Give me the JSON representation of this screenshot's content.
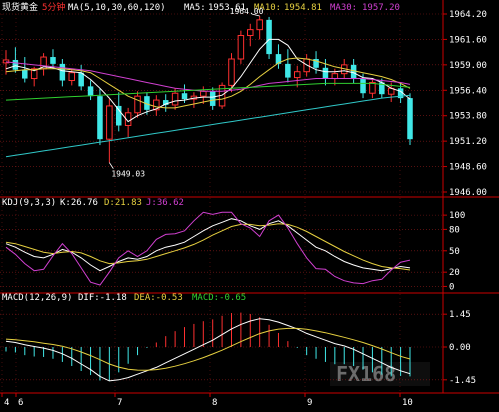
{
  "main_panel": {
    "symbol": "现货黄金",
    "period": "5分钟",
    "indicator": "MA(5,10,30,60,120)",
    "ma5_label": "MA5:",
    "ma5_value": "1953.61",
    "ma10_label": "MA10:",
    "ma10_value": "1954.81",
    "ma30_label": "MA30:",
    "ma30_value": "1957.20",
    "high_label": "1964.00",
    "low_label": "1949.03",
    "ticks": [
      "1964.20",
      "1961.60",
      "1959.00",
      "1956.40",
      "1953.80",
      "1951.20",
      "1948.60",
      "1946.00"
    ]
  },
  "kdj_panel": {
    "title": "KDJ(9,3,3)",
    "k_text": "K:26.76",
    "d_text": "D:21.83",
    "j_text": "J:36.62",
    "ticks": [
      "100",
      "80",
      "50",
      "20",
      "0"
    ]
  },
  "macd_panel": {
    "title": "MACD(12,26,9)",
    "dif_text": "DIF:-1.18",
    "dea_text": "DEA:-0.53",
    "macd_text": "MACD:-0.65",
    "ticks": [
      "1.45",
      "0.00",
      "-1.45"
    ]
  },
  "x_axis": {
    "labels": [
      "4",
      "6",
      "7",
      "8",
      "9",
      "10"
    ]
  },
  "watermark": "FX168",
  "colors": {
    "background": "#000000",
    "up": "#ff3030",
    "down": "#40e8e8",
    "ma5": "#ffffff",
    "ma10": "#e6d040",
    "ma30": "#d040d0",
    "ma60": "#30d030",
    "ma120": "#30c8c8",
    "grid": "#8a1a1a",
    "separator": "#cc0000"
  },
  "chart_data": [
    {
      "type": "candlestick",
      "panel": "price",
      "ylim": [
        1946.0,
        1964.2
      ],
      "x_labels": [
        "4",
        "6",
        "7",
        "8",
        "9",
        "10"
      ],
      "series": [
        {
          "name": "candles",
          "ohlc": [
            [
              1959.2,
              1960.5,
              1958.0,
              1959.5
            ],
            [
              1959.5,
              1960.8,
              1958.2,
              1958.5
            ],
            [
              1958.5,
              1959.8,
              1957.2,
              1957.6
            ],
            [
              1957.6,
              1958.8,
              1956.8,
              1958.6
            ],
            [
              1958.6,
              1960.2,
              1957.9,
              1959.8
            ],
            [
              1959.8,
              1960.6,
              1958.6,
              1959.1
            ],
            [
              1959.1,
              1959.6,
              1956.8,
              1957.4
            ],
            [
              1957.4,
              1958.6,
              1956.9,
              1958.2
            ],
            [
              1958.2,
              1959.0,
              1956.4,
              1956.8
            ],
            [
              1956.8,
              1957.4,
              1955.4,
              1955.8
            ],
            [
              1955.8,
              1956.6,
              1950.8,
              1951.4
            ],
            [
              1951.4,
              1955.5,
              1949.0,
              1954.8
            ],
            [
              1954.8,
              1956.2,
              1952.2,
              1952.8
            ],
            [
              1952.8,
              1954.6,
              1951.6,
              1954.1
            ],
            [
              1954.1,
              1956.3,
              1953.6,
              1955.8
            ],
            [
              1955.8,
              1956.2,
              1953.9,
              1954.4
            ],
            [
              1954.4,
              1955.9,
              1953.8,
              1955.4
            ],
            [
              1955.4,
              1956.0,
              1954.2,
              1954.9
            ],
            [
              1954.9,
              1956.6,
              1954.4,
              1956.1
            ],
            [
              1956.1,
              1957.0,
              1955.1,
              1955.5
            ],
            [
              1955.5,
              1956.2,
              1954.6,
              1955.8
            ],
            [
              1955.8,
              1956.8,
              1955.0,
              1956.3
            ],
            [
              1956.3,
              1956.7,
              1954.4,
              1954.8
            ],
            [
              1954.8,
              1957.2,
              1954.5,
              1956.9
            ],
            [
              1956.9,
              1960.2,
              1956.2,
              1959.6
            ],
            [
              1959.6,
              1962.5,
              1959.1,
              1962.0
            ],
            [
              1962.0,
              1963.2,
              1960.9,
              1962.6
            ],
            [
              1962.6,
              1964.0,
              1961.6,
              1963.6
            ],
            [
              1963.6,
              1963.9,
              1959.6,
              1960.1
            ],
            [
              1960.1,
              1961.1,
              1958.6,
              1959.1
            ],
            [
              1959.1,
              1960.6,
              1957.2,
              1957.7
            ],
            [
              1957.7,
              1958.9,
              1956.7,
              1958.3
            ],
            [
              1958.3,
              1960.1,
              1957.8,
              1959.6
            ],
            [
              1959.6,
              1960.4,
              1958.1,
              1958.7
            ],
            [
              1958.7,
              1959.6,
              1956.9,
              1957.6
            ],
            [
              1957.6,
              1958.6,
              1956.9,
              1958.1
            ],
            [
              1958.1,
              1959.6,
              1957.6,
              1959.0
            ],
            [
              1959.0,
              1959.6,
              1957.1,
              1957.6
            ],
            [
              1957.6,
              1958.1,
              1955.6,
              1956.1
            ],
            [
              1956.1,
              1957.6,
              1955.6,
              1957.2
            ],
            [
              1957.2,
              1957.6,
              1955.6,
              1956.0
            ],
            [
              1956.0,
              1957.2,
              1955.2,
              1956.6
            ],
            [
              1956.6,
              1957.1,
              1955.1,
              1955.6
            ],
            [
              1955.6,
              1956.1,
              1950.8,
              1951.4
            ]
          ]
        },
        {
          "name": "MA5",
          "values": [
            1958.6,
            1958.9,
            1958.7,
            1958.4,
            1958.8,
            1958.7,
            1958.4,
            1958.3,
            1958.2,
            1957.5,
            1956.6,
            1955.6,
            1954.4,
            1953.2,
            1953.8,
            1954.2,
            1954.5,
            1955.0,
            1955.3,
            1955.4,
            1955.6,
            1955.7,
            1955.7,
            1955.9,
            1956.6,
            1957.8,
            1959.2,
            1960.6,
            1961.6,
            1961.6,
            1961.0,
            1959.6,
            1959.0,
            1958.5,
            1958.3,
            1958.3,
            1958.4,
            1958.2,
            1957.7,
            1957.6,
            1957.2,
            1956.6,
            1956.3,
            1955.5
          ]
        },
        {
          "name": "MA10",
          "values": [
            1958.3,
            1958.4,
            1958.5,
            1958.5,
            1958.6,
            1958.6,
            1958.6,
            1958.5,
            1958.4,
            1958.2,
            1957.6,
            1957.0,
            1956.4,
            1955.8,
            1955.4,
            1955.0,
            1954.7,
            1954.6,
            1954.6,
            1954.8,
            1955.0,
            1955.2,
            1955.4,
            1955.5,
            1955.8,
            1956.3,
            1957.0,
            1957.8,
            1958.5,
            1959.2,
            1959.6,
            1959.7,
            1959.6,
            1959.4,
            1959.1,
            1958.8,
            1958.6,
            1958.4,
            1958.2,
            1958.0,
            1957.8,
            1957.5,
            1957.1,
            1956.6
          ]
        },
        {
          "name": "MA30",
          "values": [
            1959.3,
            1959.2,
            1959.1,
            1959.0,
            1958.9,
            1958.8,
            1958.7,
            1958.6,
            1958.5,
            1958.4,
            1958.2,
            1958.0,
            1957.8,
            1957.6,
            1957.4,
            1957.2,
            1957.0,
            1956.8,
            1956.6,
            1956.5,
            1956.4,
            1956.3,
            1956.3,
            1956.3,
            1956.4,
            1956.5,
            1956.7,
            1956.9,
            1957.1,
            1957.2,
            1957.3,
            1957.4,
            1957.5,
            1957.6,
            1957.6,
            1957.6,
            1957.6,
            1957.6,
            1957.6,
            1957.5,
            1957.4,
            1957.3,
            1957.2,
            1957.0
          ]
        },
        {
          "name": "MA60",
          "values": [
            1955.4,
            1955.45,
            1955.5,
            1955.55,
            1955.6,
            1955.65,
            1955.7,
            1955.75,
            1955.8,
            1955.85,
            1955.9,
            1955.95,
            1956.0,
            1956.05,
            1956.1,
            1956.15,
            1956.2,
            1956.25,
            1956.3,
            1956.35,
            1956.4,
            1956.45,
            1956.5,
            1956.55,
            1956.6,
            1956.65,
            1956.7,
            1956.75,
            1956.8,
            1956.85,
            1956.9,
            1956.95,
            1957.0,
            1957.05,
            1957.1,
            1957.1,
            1957.1,
            1957.1,
            1957.1,
            1957.1,
            1957.0,
            1956.9,
            1956.8,
            1956.7
          ]
        },
        {
          "name": "MA120",
          "values": [
            1949.6,
            1949.75,
            1949.9,
            1950.05,
            1950.2,
            1950.35,
            1950.5,
            1950.65,
            1950.8,
            1950.95,
            1951.1,
            1951.25,
            1951.4,
            1951.55,
            1951.7,
            1951.85,
            1952.0,
            1952.15,
            1952.3,
            1952.45,
            1952.6,
            1952.75,
            1952.9,
            1953.05,
            1953.2,
            1953.35,
            1953.5,
            1953.65,
            1953.8,
            1953.95,
            1954.1,
            1954.25,
            1954.4,
            1954.55,
            1954.7,
            1954.85,
            1955.0,
            1955.15,
            1955.3,
            1955.45,
            1955.6,
            1955.7,
            1955.8,
            1955.9
          ]
        }
      ]
    },
    {
      "type": "line",
      "panel": "kdj",
      "ylim": [
        -5,
        110
      ],
      "series": [
        {
          "name": "K",
          "values": [
            60,
            55,
            48,
            42,
            40,
            45,
            52,
            48,
            40,
            30,
            22,
            28,
            35,
            40,
            38,
            42,
            50,
            55,
            58,
            62,
            70,
            78,
            85,
            90,
            95,
            92,
            85,
            80,
            88,
            92,
            85,
            75,
            65,
            55,
            50,
            42,
            35,
            30,
            26,
            24,
            22,
            25,
            28,
            26
          ]
        },
        {
          "name": "D",
          "values": [
            62,
            60,
            56,
            52,
            48,
            46,
            48,
            49,
            47,
            42,
            36,
            32,
            33,
            35,
            36,
            38,
            42,
            46,
            50,
            54,
            59,
            65,
            72,
            78,
            84,
            87,
            87,
            85,
            86,
            88,
            87,
            83,
            77,
            70,
            63,
            56,
            49,
            43,
            37,
            32,
            28,
            26,
            25,
            23
          ]
        },
        {
          "name": "J",
          "values": [
            55,
            45,
            32,
            22,
            24,
            43,
            60,
            46,
            26,
            6,
            2,
            20,
            40,
            50,
            42,
            50,
            66,
            73,
            74,
            78,
            92,
            104,
            101,
            104,
            104,
            88,
            82,
            70,
            92,
            100,
            82,
            60,
            40,
            25,
            24,
            14,
            8,
            5,
            4,
            8,
            10,
            23,
            34,
            37
          ]
        }
      ]
    },
    {
      "type": "bar+line",
      "panel": "macd",
      "ylim": [
        -1.9,
        1.9
      ],
      "series": [
        {
          "name": "DIF",
          "values": [
            0.25,
            0.2,
            0.1,
            0.02,
            -0.05,
            -0.15,
            -0.3,
            -0.5,
            -0.75,
            -1.0,
            -1.3,
            -1.5,
            -1.45,
            -1.35,
            -1.2,
            -1.05,
            -0.9,
            -0.7,
            -0.5,
            -0.3,
            -0.1,
            0.1,
            0.3,
            0.55,
            0.8,
            1.0,
            1.15,
            1.25,
            1.2,
            1.1,
            0.95,
            0.8,
            0.6,
            0.45,
            0.3,
            0.15,
            0.05,
            -0.1,
            -0.3,
            -0.5,
            -0.7,
            -0.9,
            -1.05,
            -1.18
          ]
        },
        {
          "name": "DEA",
          "values": [
            0.35,
            0.32,
            0.28,
            0.23,
            0.17,
            0.11,
            0.03,
            -0.08,
            -0.22,
            -0.38,
            -0.56,
            -0.75,
            -0.89,
            -0.98,
            -1.02,
            -1.03,
            -1.0,
            -0.94,
            -0.85,
            -0.74,
            -0.61,
            -0.47,
            -0.31,
            -0.14,
            0.05,
            0.24,
            0.42,
            0.59,
            0.71,
            0.79,
            0.82,
            0.82,
            0.78,
            0.71,
            0.63,
            0.53,
            0.43,
            0.32,
            0.2,
            0.06,
            -0.09,
            -0.25,
            -0.41,
            -0.53
          ]
        },
        {
          "name": "MACD",
          "values": [
            -0.2,
            -0.24,
            -0.36,
            -0.42,
            -0.44,
            -0.52,
            -0.66,
            -0.84,
            -1.06,
            -1.24,
            -1.48,
            -1.5,
            -1.12,
            -0.74,
            -0.36,
            -0.04,
            0.2,
            0.48,
            0.7,
            0.88,
            1.02,
            1.14,
            1.22,
            1.38,
            1.5,
            1.52,
            1.46,
            1.32,
            0.98,
            0.62,
            0.26,
            -0.04,
            -0.36,
            -0.52,
            -0.66,
            -0.76,
            -0.76,
            -0.84,
            -1.0,
            -1.12,
            -1.22,
            -1.3,
            -1.28,
            -1.3
          ]
        }
      ]
    }
  ]
}
